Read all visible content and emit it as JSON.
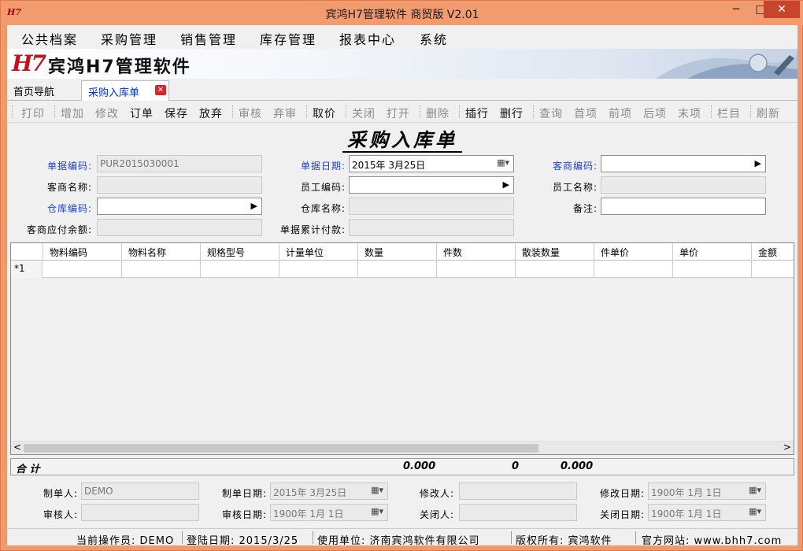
{
  "window": {
    "title": "宾鸿H7管理软件 商贸版 V2.01",
    "icon": "H7",
    "min": "─",
    "max": "□",
    "close": "✕"
  },
  "menu": [
    "公共档案",
    "采购管理",
    "销售管理",
    "库存管理",
    "报表中心",
    "系统"
  ],
  "banner": {
    "logo": "H7",
    "name": "宾鸿H7管理软件"
  },
  "tabs": {
    "home": "首页导航",
    "active": "采购入库单",
    "close": "✕"
  },
  "toolbar": [
    {
      "label": "打印",
      "enabled": false
    },
    {
      "label": "增加",
      "enabled": false
    },
    {
      "label": "修改",
      "enabled": false
    },
    {
      "label": "订单",
      "enabled": true
    },
    {
      "label": "保存",
      "enabled": true
    },
    {
      "label": "放弃",
      "enabled": true
    },
    {
      "label": "审核",
      "enabled": false
    },
    {
      "label": "弃审",
      "enabled": false
    },
    {
      "label": "取价",
      "enabled": true
    },
    {
      "label": "关闭",
      "enabled": false
    },
    {
      "label": "打开",
      "enabled": false
    },
    {
      "label": "删除",
      "enabled": false
    },
    {
      "label": "插行",
      "enabled": true
    },
    {
      "label": "删行",
      "enabled": true
    },
    {
      "label": "查询",
      "enabled": false
    },
    {
      "label": "首项",
      "enabled": false
    },
    {
      "label": "前项",
      "enabled": false
    },
    {
      "label": "后项",
      "enabled": false
    },
    {
      "label": "末项",
      "enabled": false
    },
    {
      "label": "栏目",
      "enabled": false
    },
    {
      "label": "刷新",
      "enabled": false
    }
  ],
  "form_title": "采购入库单",
  "fields": {
    "doc_no": {
      "label": "单据编码:",
      "value": "PUR2015030001"
    },
    "doc_date": {
      "label": "单据日期:",
      "value": "2015年 3月25日"
    },
    "cust_code": {
      "label": "客商编码:",
      "value": ""
    },
    "cust_name": {
      "label": "客商名称:",
      "value": ""
    },
    "emp_code": {
      "label": "员工编码:",
      "value": ""
    },
    "emp_name": {
      "label": "员工名称:",
      "value": ""
    },
    "wh_code": {
      "label": "仓库编码:",
      "value": ""
    },
    "wh_name": {
      "label": "仓库名称:",
      "value": ""
    },
    "remark": {
      "label": "备注:",
      "value": ""
    },
    "cust_balance": {
      "label": "客商应付余额:",
      "value": ""
    },
    "doc_paid": {
      "label": "单据累计付款:",
      "value": ""
    }
  },
  "grid": {
    "columns": [
      "物料编码",
      "物料名称",
      "规格型号",
      "计量单位",
      "数量",
      "件数",
      "散装数量",
      "件单价",
      "单价",
      "金额"
    ],
    "rows": [
      {
        "indicator": "*1"
      }
    ],
    "scroll_left": "<",
    "scroll_right": ">"
  },
  "totals": {
    "label": "合 计",
    "amount1": "0.000",
    "count": "0",
    "amount2": "0.000"
  },
  "footer": {
    "maker": {
      "label": "制单人:",
      "value": "DEMO"
    },
    "make_date": {
      "label": "制单日期:",
      "value": "2015年 3月25日"
    },
    "modifier": {
      "label": "修改人:",
      "value": ""
    },
    "modify_date": {
      "label": "修改日期:",
      "value": "1900年 1月 1日"
    },
    "auditor": {
      "label": "审核人:",
      "value": ""
    },
    "audit_date": {
      "label": "审核日期:",
      "value": "1900年 1月 1日"
    },
    "closer": {
      "label": "关闭人:",
      "value": ""
    },
    "close_date": {
      "label": "关闭日期:",
      "value": "1900年 1月 1日"
    }
  },
  "status": {
    "operator": "当前操作员: DEMO",
    "login_date": "登陆日期: 2015/3/25",
    "unit": "使用单位: 济南宾鸿软件有限公司",
    "copyright": "版权所有: 宾鸿软件",
    "website": "官方网站: www.bhh7.com"
  }
}
